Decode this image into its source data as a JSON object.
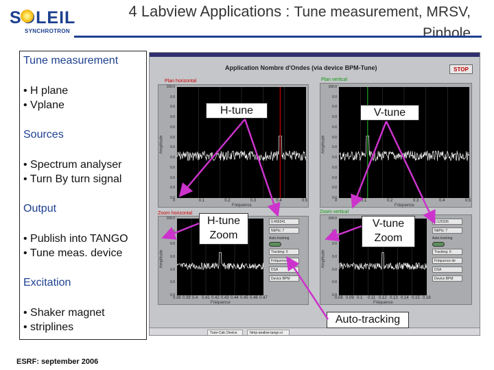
{
  "header": {
    "logo_text": "SOLEIL",
    "logo_subtext": "SYNCHROTRON",
    "title_line1": "4 Labview Applications : ",
    "title_line1_rest": "Tune measurement, MRSV,",
    "title_line2": "Pinhole"
  },
  "left_panel": {
    "sections": [
      {
        "heading": "Tune measurement",
        "items": [
          "• H plane",
          "• Vplane"
        ]
      },
      {
        "heading": "Sources",
        "items": [
          "• Spectrum analyser",
          "• Turn By turn signal"
        ]
      },
      {
        "heading": "Output",
        "items": [
          "• Publish into TANGO",
          "• Tune meas. device"
        ]
      },
      {
        "heading": "Excitation",
        "items": [
          "• Shaker magnet",
          "• striplines"
        ]
      }
    ]
  },
  "footer": "ESRF: september 2006",
  "screenshot": {
    "app_title": "Application Nombre d'Ondes (via device BPM-Tune)",
    "stop_label": "STOP",
    "plan_h_label": "Plan horizontal",
    "plan_v_label": "Plan vertical",
    "zoom_h_label": "Zoom horizontal",
    "zoom_v_label": "Zoom vertical",
    "y_ticks": [
      "100.0",
      "0.0",
      "0.0",
      "0.0",
      "0.0",
      "0.0",
      "0.0",
      "0.0",
      "0.0",
      "0.0",
      "0.0",
      "0.0"
    ],
    "x_ticks_main": [
      "0",
      "0.1",
      "0.2",
      "0.3",
      "0.4",
      "0.5"
    ],
    "x_ticks_zoom_h": [
      "0.38",
      "0.39",
      "0.4",
      "0.41",
      "0.42",
      "0.43",
      "0.44",
      "0.45",
      "0.46",
      "0.47"
    ],
    "x_ticks_zoom_v": [
      "0.08",
      "0.09",
      "0.1",
      "0.11",
      "0.12",
      "0.13",
      "0.14",
      "0.15",
      "0.16"
    ],
    "x_axis_name": "Fréquence",
    "y_axis_name": "Amplitude",
    "zoom_h_controls": [
      "0.466341",
      "NbPts: 7",
      "Auto-tracking",
      "Tracking: 0",
      "Fréquence de",
      "DSA",
      "Device BPM"
    ],
    "zoom_v_controls": [
      "0.125336",
      "NbPts: 7",
      "Auto-tracking",
      "Tracking: 0",
      "Fréquence de",
      "DSA",
      "Device BPM"
    ],
    "taskbar_tasks": [
      "Tune-Calc Device",
      "htmp-analise-tango.vi"
    ]
  },
  "callouts": {
    "h_tune": "H-tune",
    "v_tune": "V-tune",
    "h_tune_zoom_line1": "H-tune",
    "h_tune_zoom_line2": "Zoom",
    "v_tune_zoom_line1": "V-tune",
    "v_tune_zoom_line2": "Zoom",
    "auto_tracking": "Auto-tracking"
  },
  "colors": {
    "brand_blue": "#1c3f8f",
    "arrow_magenta": "#cc33cc",
    "marker_red": "#cc0000",
    "marker_green": "#22aa22"
  }
}
